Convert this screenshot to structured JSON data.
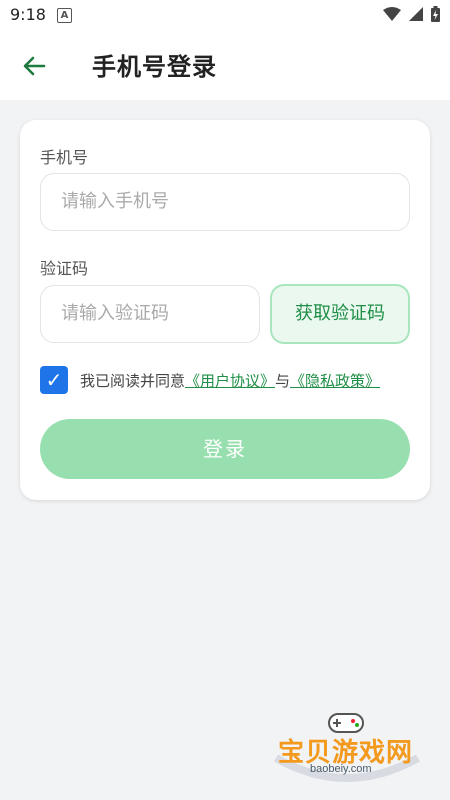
{
  "status_bar": {
    "time": "9:18",
    "app_icon": "A"
  },
  "app_bar": {
    "title": "手机号登录"
  },
  "form": {
    "phone_label": "手机号",
    "phone_placeholder": "请输入手机号",
    "code_label": "验证码",
    "code_placeholder": "请输入验证码",
    "get_code_label": "获取验证码",
    "agreement": {
      "prefix": "我已阅读并同意",
      "user_agreement": "《用户协议》",
      "connector": "与",
      "privacy_policy": "《隐私政策》",
      "checked": true
    },
    "login_label": "登录"
  },
  "watermark": {
    "name": "宝贝游戏网",
    "url": "baobeiy.com"
  },
  "colors": {
    "accent_green": "#1f8e46",
    "button_green": "#97dfae",
    "checkbox_blue": "#1f74e8",
    "background": "#f2f3f5"
  }
}
